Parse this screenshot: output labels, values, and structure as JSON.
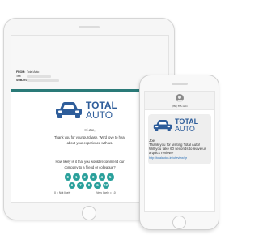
{
  "email": {
    "header": {
      "from_label": "FROM:",
      "from_value": "Total Auto",
      "to_label": "TO:",
      "subject_label": "SUBJECT:"
    },
    "brand": {
      "name_top": "TOTAL",
      "name_bottom": "AUTO"
    },
    "greeting": "Hi Joe,",
    "message_line1": "Thank you for your purchase. We'd love to hear",
    "message_line2": "about your experience with us.",
    "question_line1": "How likely is it that you would recommend our",
    "question_line2": "company to a friend or colleague?",
    "nps_row1": [
      "0",
      "1",
      "2",
      "3",
      "4",
      "5"
    ],
    "nps_row2": [
      "6",
      "7",
      "8",
      "9",
      "10"
    ],
    "scale_low": "0 = Not likely",
    "scale_high": "Very likely = 10"
  },
  "sms": {
    "phone_number": "(888) 555-1234",
    "brand_top": "TOTAL",
    "brand_bottom": "AUTO",
    "message_line1": "Joe,",
    "message_line2": "Thank you for visiting Total Auto!",
    "message_line3": "Will you take 60 seconds to leave us",
    "message_line4": "a quick review?",
    "link": "http://totalautos.info/review/gr"
  },
  "colors": {
    "brand_blue": "#2e5d9a",
    "teal": "#2aa09b",
    "accent_line": "#2a7a78"
  }
}
